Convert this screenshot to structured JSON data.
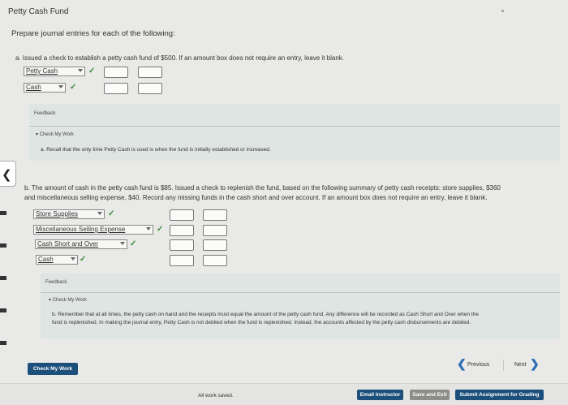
{
  "title": "Petty Cash Fund",
  "instructions": "Prepare journal entries for each of the following:",
  "part_a": {
    "text": "a. Issued a check to establish a petty cash fund of $500. If an amount box does not require an entry, leave it blank.",
    "rows": [
      {
        "account": "Petty Cash"
      },
      {
        "account": "Cash"
      }
    ],
    "feedback_title": "Feedback",
    "check_label": "Check My Work",
    "feedback_text": "a. Recall that the only time Petty Cash is used is when the fund is initially established or increased."
  },
  "part_b": {
    "text_line1": "b. The amount of cash in the petty cash fund is $85. Issued a check to replenish the fund, based on the following summary of petty cash receipts: store supplies, $360",
    "text_line2": "and miscellaneous selling expense, $40. Record any missing funds in the cash short and over account. If an amount box does not require an entry, leave it blank.",
    "rows": [
      {
        "account": "Store Supplies"
      },
      {
        "account": "Miscellaneous Selling Expense"
      },
      {
        "account": "Cash Short and Over"
      },
      {
        "account": "Cash"
      }
    ],
    "feedback_title": "Feedback",
    "check_label": "Check My Work",
    "feedback_line1": "b. Remember that at all times, the petty cash on hand and the receipts must equal the amount of the petty cash fund. Any difference will be recorded as Cash Short and Over when the",
    "feedback_line2": "fund is replenished. In making the journal entry, Petty Cash is not debited when the fund is replenished. Instead, the accounts affected by the petty cash disbursements are debited."
  },
  "buttons": {
    "check_my_work": "Check My Work",
    "previous": "Previous",
    "next": "Next",
    "email_instructor": "Email Instructor",
    "save_and_exit": "Save and Exit",
    "submit": "Submit Assignment for Grading"
  },
  "status": "All work saved.",
  "check_mark": "✓",
  "colors": {
    "accent": "#1c4f7a",
    "check": "#3a8c3a",
    "nav": "#2a6db5"
  }
}
